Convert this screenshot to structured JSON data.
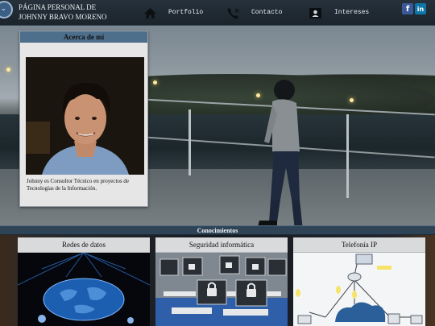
{
  "header": {
    "title_line1": "PÁGINA PERSONAL DE",
    "title_line2": "JOHNNY BRAVO MORENO",
    "nav": [
      {
        "label": "Portfolio",
        "icon": "home-icon"
      },
      {
        "label": "Contacto",
        "icon": "phone-icon"
      },
      {
        "label": "Intereses",
        "icon": "contact-card-icon"
      }
    ],
    "social": [
      {
        "label": "f",
        "icon": "facebook-icon",
        "color": "#3b5998"
      },
      {
        "label": "in",
        "icon": "linkedin-icon",
        "color": "#0e76a8"
      }
    ]
  },
  "about": {
    "heading": "Acerca de mí",
    "text": "Johnny es Consultor Técnico en proyectos de Tecnologías de la Información."
  },
  "knowledge": {
    "heading": "Conocimientos",
    "cards": [
      {
        "title": "Redes de datos"
      },
      {
        "title": "Seguridad informática"
      },
      {
        "title": "Telefonía IP"
      }
    ]
  },
  "colors": {
    "accent": "#4d6f8c",
    "band": "#2e4456",
    "topbar": "#1f2931"
  }
}
